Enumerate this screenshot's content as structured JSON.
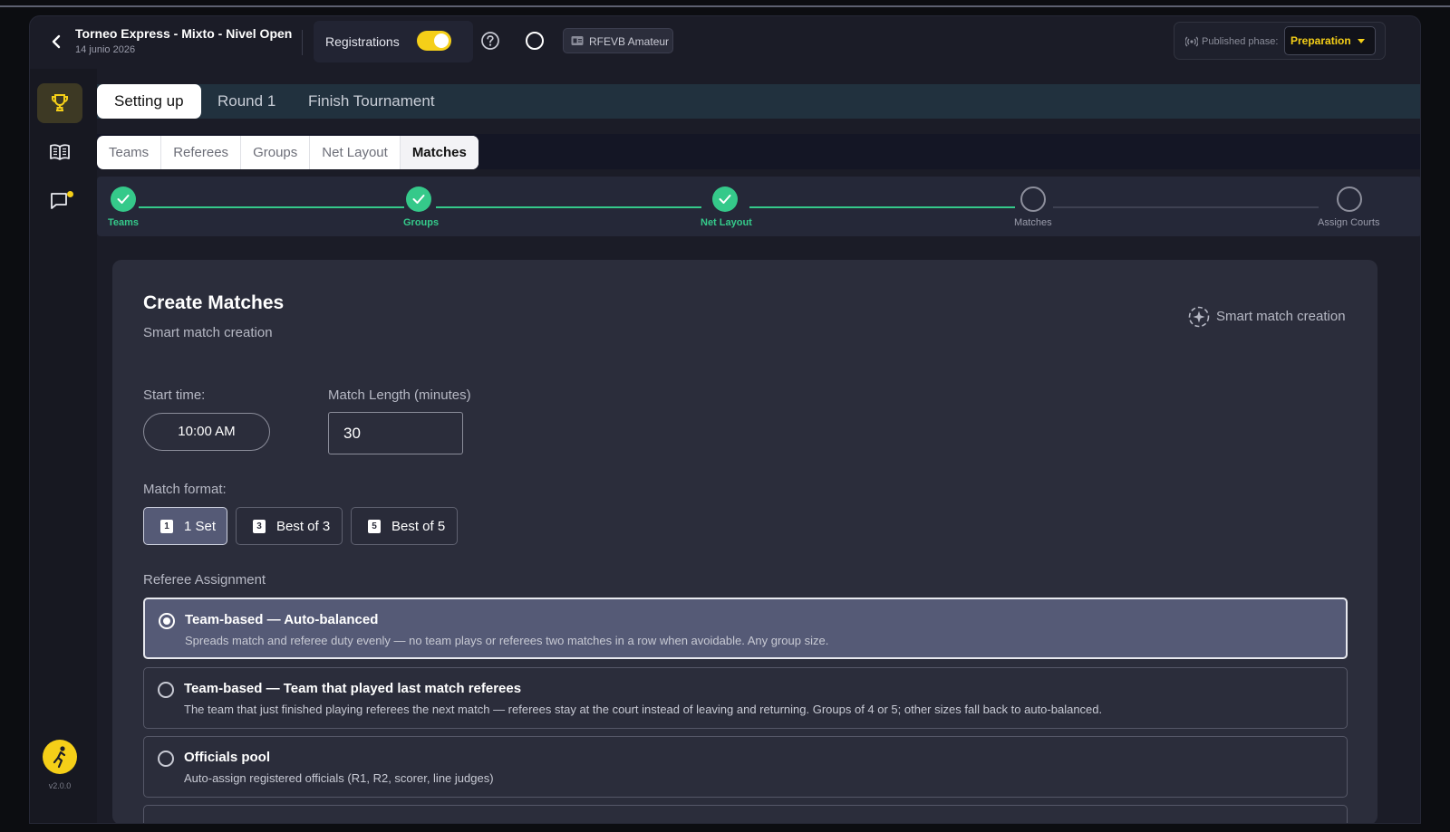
{
  "header": {
    "title": "Torneo Express - Mixto - Nivel Open",
    "date": "14 junio 2026",
    "registrations_label": "Registrations",
    "registrations_on": true,
    "org_label": "RFEVB Amateur",
    "published_phase_label": "Published phase:",
    "published_phase_value": "Preparation"
  },
  "sidebar": {
    "items": [
      "trophy-icon",
      "book-icon",
      "chat-icon"
    ],
    "version": "v2.0.0"
  },
  "tabs": [
    {
      "label": "Setting up",
      "active": true
    },
    {
      "label": "Round 1",
      "active": false
    },
    {
      "label": "Finish Tournament",
      "active": false
    }
  ],
  "subtabs": [
    {
      "label": "Teams"
    },
    {
      "label": "Referees"
    },
    {
      "label": "Groups"
    },
    {
      "label": "Net Layout"
    },
    {
      "label": "Matches",
      "active": true
    }
  ],
  "stepper": [
    {
      "label": "Teams",
      "done": true
    },
    {
      "label": "Groups",
      "done": true
    },
    {
      "label": "Net Layout",
      "done": true
    },
    {
      "label": "Matches",
      "done": false
    },
    {
      "label": "Assign Courts",
      "done": false
    }
  ],
  "card": {
    "title": "Create Matches",
    "subtitle": "Smart match creation",
    "smart_label": "Smart match creation",
    "start_time_label": "Start time:",
    "start_time_value": "10:00 AM",
    "match_length_label": "Match Length (minutes)",
    "match_length_value": "30",
    "match_format_label": "Match format:",
    "formats": [
      {
        "num": "1",
        "label": "1 Set",
        "active": true
      },
      {
        "num": "3",
        "label": "Best of 3",
        "active": false
      },
      {
        "num": "5",
        "label": "Best of 5",
        "active": false
      }
    ],
    "referee_label": "Referee Assignment",
    "referee_options": [
      {
        "title": "Team-based — Auto-balanced",
        "desc": "Spreads match and referee duty evenly — no team plays or referees two matches in a row when avoidable. Any group size.",
        "selected": true
      },
      {
        "title": "Team-based — Team that played last match referees",
        "desc": "The team that just finished playing referees the next match — referees stay at the court instead of leaving and returning. Groups of 4 or 5; other sizes fall back to auto-balanced.",
        "selected": false
      },
      {
        "title": "Officials pool",
        "desc": "Auto-assign registered officials (R1, R2, scorer, line judges)",
        "selected": false
      }
    ]
  },
  "colors": {
    "accent": "#f5cf18",
    "success": "#35c98a",
    "background": "#1b1c27",
    "card": "#2b2d3b"
  }
}
